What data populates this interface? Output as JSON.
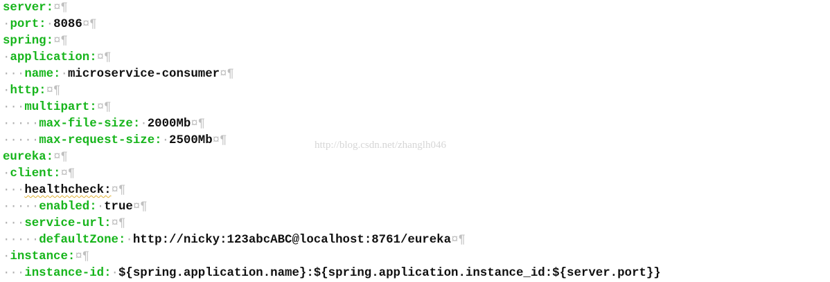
{
  "window": {
    "content_kind": "yaml-editor",
    "colors": {
      "key": "#17b51c",
      "value": "#101010",
      "whitespace_marker": "#b0b0b0",
      "line_end_marker": "#c0c0c0",
      "watermark": "#d6d6d6"
    }
  },
  "editor": {
    "lines": [
      {
        "ws": "",
        "key": "server:",
        "value": "",
        "end": "¤¶"
      },
      {
        "ws": "·",
        "key": "port:",
        "value": "8086",
        "end": "¤¶"
      },
      {
        "ws": "",
        "key": "spring:",
        "value": "",
        "end": "¤¶"
      },
      {
        "ws": "·",
        "key": "application:",
        "value": "",
        "end": "¤¶"
      },
      {
        "ws": "···",
        "key": "name:",
        "value": "microservice-consumer",
        "end": "¤¶"
      },
      {
        "ws": "·",
        "key": "http:",
        "value": "",
        "end": "¤¶"
      },
      {
        "ws": "···",
        "key": "multipart:",
        "value": "",
        "end": "¤¶"
      },
      {
        "ws": "·····",
        "key": "max-file-size:",
        "value": "2000Mb",
        "end": "¤¶"
      },
      {
        "ws": "·····",
        "key": "max-request-size:",
        "value": "2500Mb",
        "end": "¤¶"
      },
      {
        "ws": "",
        "key": "eureka:",
        "value": "",
        "end": "¤¶"
      },
      {
        "ws": "·",
        "key": "client:",
        "value": "",
        "end": "¤¶"
      },
      {
        "ws": "···",
        "key": "healthcheck:",
        "value": "",
        "end": "¤¶"
      },
      {
        "ws": "·····",
        "key": "enabled:",
        "value": "true",
        "end": "¤¶"
      },
      {
        "ws": "···",
        "key": "service-url:",
        "value": "",
        "end": "¤¶"
      },
      {
        "ws": "·····",
        "key": "defaultZone:",
        "value": "http://nicky:123abcABC@localhost:8761/eureka",
        "end": "¤¶"
      },
      {
        "ws": "·",
        "key": "instance:",
        "value": "",
        "end": "¤¶"
      },
      {
        "ws": "···",
        "key": "instance-id:",
        "value": "${spring.application.name}:${spring.application.instance_id:${server.port}}",
        "end": ""
      }
    ]
  },
  "watermark": {
    "text": "http://blog.csdn.net/zhanglh046"
  }
}
